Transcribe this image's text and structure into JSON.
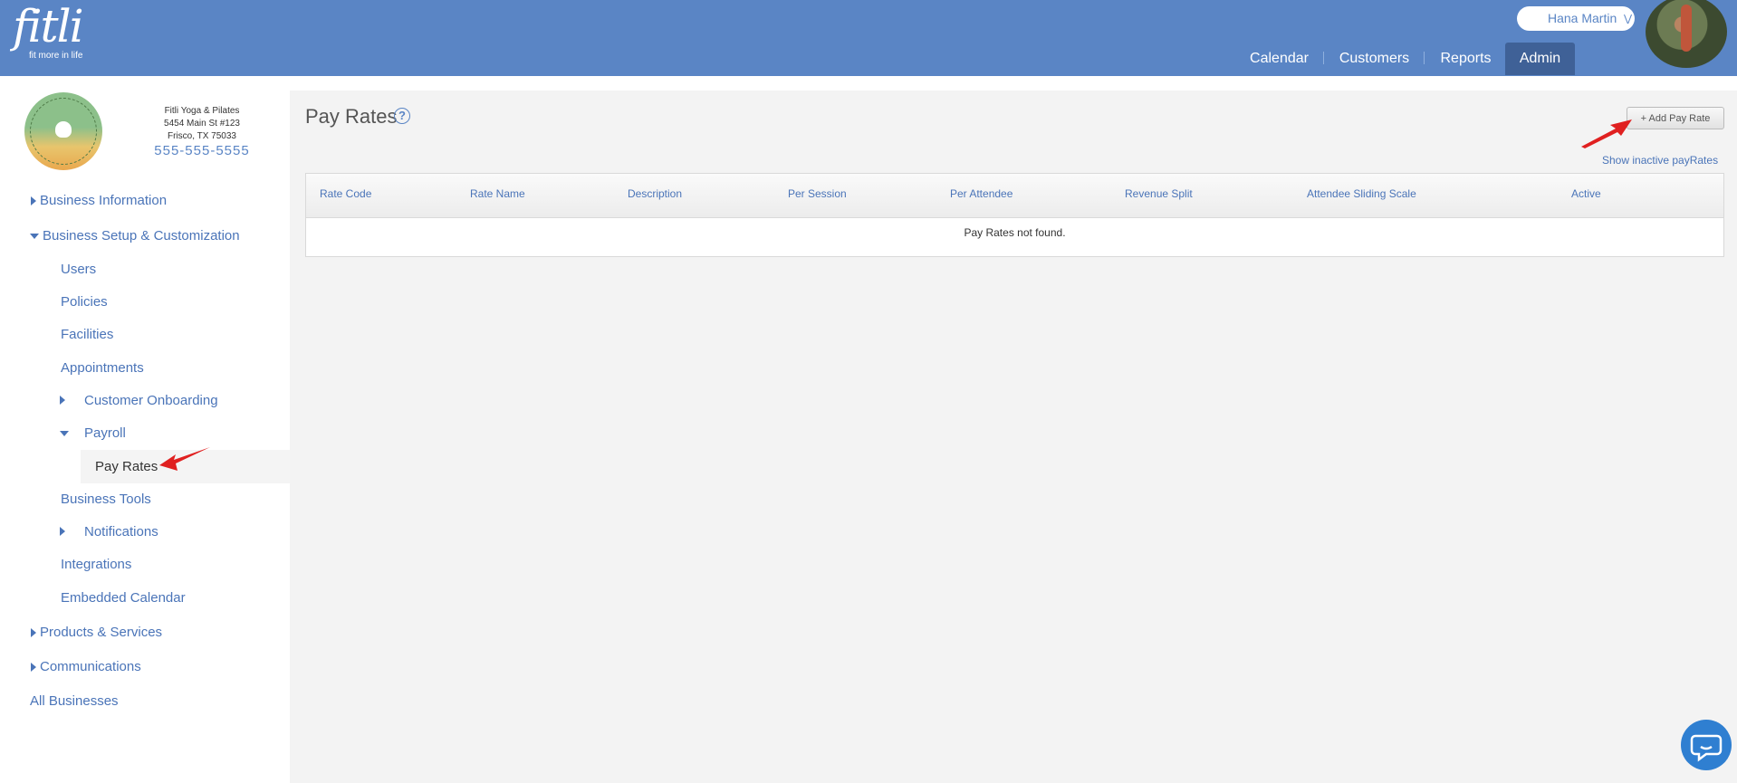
{
  "brand": {
    "name": "fitli",
    "tagline": "fit more in life"
  },
  "user": {
    "name": "Hana Martin",
    "menu_icon": "chevron-down-icon"
  },
  "topnav": {
    "items": [
      "Calendar",
      "Customers",
      "Reports",
      "Admin"
    ],
    "active": "Admin"
  },
  "business": {
    "name": "Fitli Yoga & Pilates",
    "address1": "5454 Main St #123",
    "address2": "Frisco, TX 75033",
    "phone": "555-555-5555"
  },
  "sidebar": {
    "business_information": "Business Information",
    "business_setup": "Business Setup & Customization",
    "users": "Users",
    "policies": "Policies",
    "facilities": "Facilities",
    "appointments": "Appointments",
    "customer_onboarding": "Customer Onboarding",
    "payroll": "Payroll",
    "pay_rates": "Pay Rates",
    "business_tools": "Business Tools",
    "notifications": "Notifications",
    "integrations": "Integrations",
    "embedded_calendar": "Embedded Calendar",
    "products_services": "Products & Services",
    "communications": "Communications",
    "all_businesses": "All Businesses"
  },
  "main": {
    "title": "Pay Rates",
    "help": "?",
    "add_button": "+ Add Pay Rate",
    "show_inactive": "Show inactive payRates",
    "columns": [
      "Rate Code",
      "Rate Name",
      "Description",
      "Per Session",
      "Per Attendee",
      "Revenue Split",
      "Attendee Sliding Scale",
      "Active"
    ],
    "empty_message": "Pay Rates not found."
  },
  "colors": {
    "header": "#5a85c5",
    "active_tab": "#3f6197",
    "link": "#4a74b8",
    "annotation_arrow": "#e02020"
  }
}
